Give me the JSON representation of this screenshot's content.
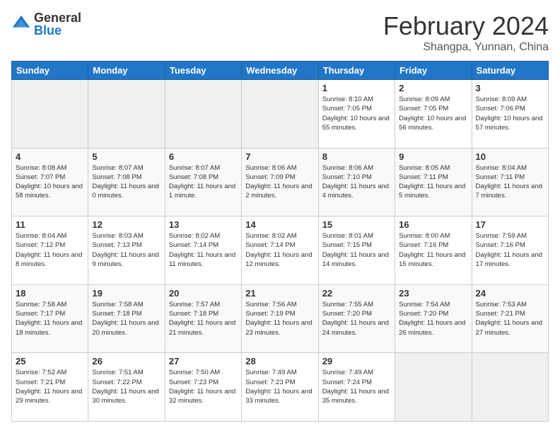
{
  "logo": {
    "general": "General",
    "blue": "Blue"
  },
  "title": "February 2024",
  "location": "Shangpa, Yunnan, China",
  "weekdays": [
    "Sunday",
    "Monday",
    "Tuesday",
    "Wednesday",
    "Thursday",
    "Friday",
    "Saturday"
  ],
  "weeks": [
    [
      {
        "day": "",
        "info": ""
      },
      {
        "day": "",
        "info": ""
      },
      {
        "day": "",
        "info": ""
      },
      {
        "day": "",
        "info": ""
      },
      {
        "day": "1",
        "info": "Sunrise: 8:10 AM\nSunset: 7:05 PM\nDaylight: 10 hours and 55 minutes."
      },
      {
        "day": "2",
        "info": "Sunrise: 8:09 AM\nSunset: 7:05 PM\nDaylight: 10 hours and 56 minutes."
      },
      {
        "day": "3",
        "info": "Sunrise: 8:09 AM\nSunset: 7:06 PM\nDaylight: 10 hours and 57 minutes."
      }
    ],
    [
      {
        "day": "4",
        "info": "Sunrise: 8:08 AM\nSunset: 7:07 PM\nDaylight: 10 hours and 58 minutes."
      },
      {
        "day": "5",
        "info": "Sunrise: 8:07 AM\nSunset: 7:08 PM\nDaylight: 11 hours and 0 minutes."
      },
      {
        "day": "6",
        "info": "Sunrise: 8:07 AM\nSunset: 7:08 PM\nDaylight: 11 hours and 1 minute."
      },
      {
        "day": "7",
        "info": "Sunrise: 8:06 AM\nSunset: 7:09 PM\nDaylight: 11 hours and 2 minutes."
      },
      {
        "day": "8",
        "info": "Sunrise: 8:06 AM\nSunset: 7:10 PM\nDaylight: 11 hours and 4 minutes."
      },
      {
        "day": "9",
        "info": "Sunrise: 8:05 AM\nSunset: 7:11 PM\nDaylight: 11 hours and 5 minutes."
      },
      {
        "day": "10",
        "info": "Sunrise: 8:04 AM\nSunset: 7:11 PM\nDaylight: 11 hours and 7 minutes."
      }
    ],
    [
      {
        "day": "11",
        "info": "Sunrise: 8:04 AM\nSunset: 7:12 PM\nDaylight: 11 hours and 8 minutes."
      },
      {
        "day": "12",
        "info": "Sunrise: 8:03 AM\nSunset: 7:13 PM\nDaylight: 11 hours and 9 minutes."
      },
      {
        "day": "13",
        "info": "Sunrise: 8:02 AM\nSunset: 7:14 PM\nDaylight: 11 hours and 11 minutes."
      },
      {
        "day": "14",
        "info": "Sunrise: 8:02 AM\nSunset: 7:14 PM\nDaylight: 11 hours and 12 minutes."
      },
      {
        "day": "15",
        "info": "Sunrise: 8:01 AM\nSunset: 7:15 PM\nDaylight: 11 hours and 14 minutes."
      },
      {
        "day": "16",
        "info": "Sunrise: 8:00 AM\nSunset: 7:16 PM\nDaylight: 11 hours and 15 minutes."
      },
      {
        "day": "17",
        "info": "Sunrise: 7:59 AM\nSunset: 7:16 PM\nDaylight: 11 hours and 17 minutes."
      }
    ],
    [
      {
        "day": "18",
        "info": "Sunrise: 7:58 AM\nSunset: 7:17 PM\nDaylight: 11 hours and 18 minutes."
      },
      {
        "day": "19",
        "info": "Sunrise: 7:58 AM\nSunset: 7:18 PM\nDaylight: 11 hours and 20 minutes."
      },
      {
        "day": "20",
        "info": "Sunrise: 7:57 AM\nSunset: 7:18 PM\nDaylight: 11 hours and 21 minutes."
      },
      {
        "day": "21",
        "info": "Sunrise: 7:56 AM\nSunset: 7:19 PM\nDaylight: 11 hours and 23 minutes."
      },
      {
        "day": "22",
        "info": "Sunrise: 7:55 AM\nSunset: 7:20 PM\nDaylight: 11 hours and 24 minutes."
      },
      {
        "day": "23",
        "info": "Sunrise: 7:54 AM\nSunset: 7:20 PM\nDaylight: 11 hours and 26 minutes."
      },
      {
        "day": "24",
        "info": "Sunrise: 7:53 AM\nSunset: 7:21 PM\nDaylight: 11 hours and 27 minutes."
      }
    ],
    [
      {
        "day": "25",
        "info": "Sunrise: 7:52 AM\nSunset: 7:21 PM\nDaylight: 11 hours and 29 minutes."
      },
      {
        "day": "26",
        "info": "Sunrise: 7:51 AM\nSunset: 7:22 PM\nDaylight: 11 hours and 30 minutes."
      },
      {
        "day": "27",
        "info": "Sunrise: 7:50 AM\nSunset: 7:23 PM\nDaylight: 11 hours and 32 minutes."
      },
      {
        "day": "28",
        "info": "Sunrise: 7:49 AM\nSunset: 7:23 PM\nDaylight: 11 hours and 33 minutes."
      },
      {
        "day": "29",
        "info": "Sunrise: 7:49 AM\nSunset: 7:24 PM\nDaylight: 11 hours and 35 minutes."
      },
      {
        "day": "",
        "info": ""
      },
      {
        "day": "",
        "info": ""
      }
    ]
  ]
}
